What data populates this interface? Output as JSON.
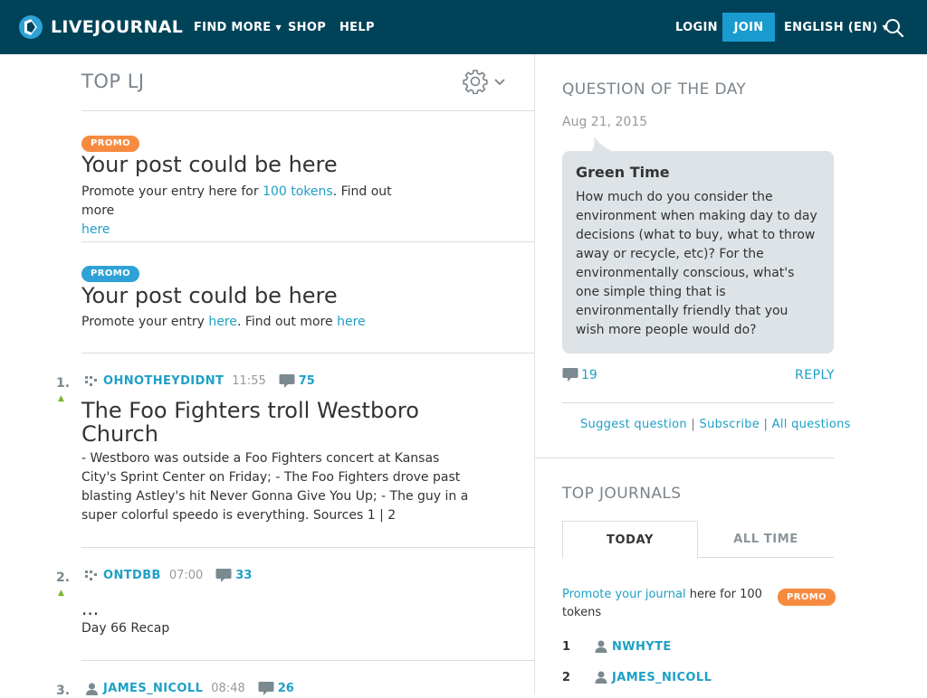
{
  "header": {
    "logo_text": "LIVEJOURNAL",
    "nav": [
      {
        "label": "FIND MORE",
        "dropdown": true
      },
      {
        "label": "SHOP",
        "dropdown": false
      },
      {
        "label": "HELP",
        "dropdown": false
      }
    ],
    "login_label": "LOGIN",
    "join_label": "JOIN",
    "language_label": "ENGLISH (EN)"
  },
  "top_lj": {
    "title": "TOP LJ",
    "promos": [
      {
        "badge": "PROMO",
        "title": "Your post could be here",
        "text_1": "Promote your entry here for ",
        "link_1": "100 tokens",
        "text_2": ". Find out more",
        "link_2": "here"
      },
      {
        "badge": "PROMO",
        "title": "Your post could be here",
        "text_1": "Promote your entry ",
        "link_1": "here",
        "text_2": ". Find out more ",
        "link_2": "here"
      }
    ],
    "entries": [
      {
        "rank": "1.",
        "author": "OHNOTHEYDIDNT",
        "time": "11:55",
        "comments": "75",
        "title": "The Foo Fighters troll Westboro Church",
        "text": "- Westboro was outside a Foo Fighters concert at Kansas City's Sprint Center on Friday; - The Foo Fighters drove past blasting Astley's hit Never Gonna Give You Up; - The guy in a super colorful speedo is everything. Sources 1 | 2"
      },
      {
        "rank": "2.",
        "author": "ONTDBB",
        "time": "07:00",
        "comments": "33",
        "title": "...",
        "text": "Day 66 Recap"
      },
      {
        "rank": "3.",
        "author": "JAMES_NICOLL",
        "time": "08:48",
        "comments": "26"
      }
    ]
  },
  "qotd": {
    "heading": "QUESTION OF THE DAY",
    "date": "Aug 21, 2015",
    "title": "Green Time",
    "text": "How much do you consider the environment when making day to day decisions (what to buy, what to throw away or recycle, etc)? For the environmentally conscious, what's one simple thing that is environmentally friendly that you wish more people would do?",
    "comments": "19",
    "reply_label": "REPLY",
    "links": [
      "Suggest question",
      "Subscribe",
      "All questions"
    ],
    "separator": "|"
  },
  "top_journals": {
    "heading": "TOP JOURNALS",
    "tabs": [
      "TODAY",
      "ALL TIME"
    ],
    "promo_link": "Promote your journal",
    "promo_text": " here for 100 tokens",
    "promo_badge": "PROMO",
    "ranks": [
      {
        "rank": "1",
        "user": "NWHYTE"
      },
      {
        "rank": "2",
        "user": "JAMES_NICOLL"
      }
    ]
  },
  "colors": {
    "header_bg": "#004359",
    "join_bg": "#1a9bd0",
    "link": "#1fa0c6",
    "promo_orange": "#f68b40",
    "promo_blue": "#2ea2d6",
    "bubble_bg": "#dde3e6",
    "up_arrow": "#7ab52e"
  }
}
